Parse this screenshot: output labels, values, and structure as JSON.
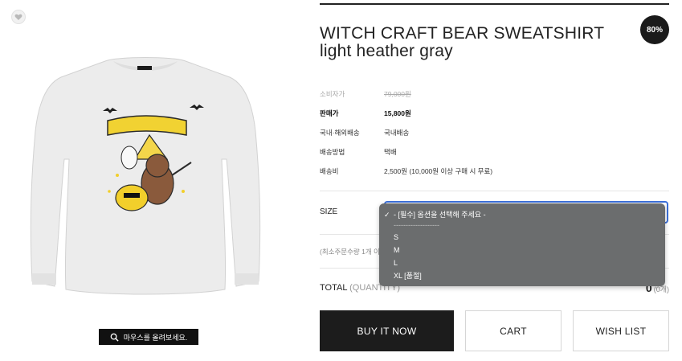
{
  "product": {
    "title_line1": "WITCH CRAFT BEAR SWEATSHIRT",
    "title_line2": "light heather gray",
    "discount_badge": "80%",
    "image_hint": "마우스를 올려보세요."
  },
  "specs": [
    {
      "label": "소비자가",
      "value": "79,000원"
    },
    {
      "label": "판매가",
      "value": "15,800원"
    },
    {
      "label": "국내·해외배송",
      "value": "국내배송"
    },
    {
      "label": "배송방법",
      "value": "택배"
    },
    {
      "label": "배송비",
      "value": "2,500원 (10,000원 이상 구매 시 무료)"
    }
  ],
  "option": {
    "label": "SIZE",
    "dropdown": {
      "selected": "- [필수] 옵션을 선택해 주세요 -",
      "separator": "-------------------",
      "options": [
        "S",
        "M",
        "L",
        "XL [품절]"
      ]
    }
  },
  "min_order": "(최소주문수량 1개 이상)",
  "total": {
    "label": "TOTAL",
    "quantity_label": "(QUANTITY)",
    "value": "0",
    "count": "(0개)"
  },
  "buttons": {
    "buy_now": "BUY IT NOW",
    "cart": "CART",
    "wish_list": "WISH LIST"
  },
  "icons": {
    "wish": "heart-icon",
    "zoom": "magnifier-icon",
    "check": "check-icon"
  }
}
